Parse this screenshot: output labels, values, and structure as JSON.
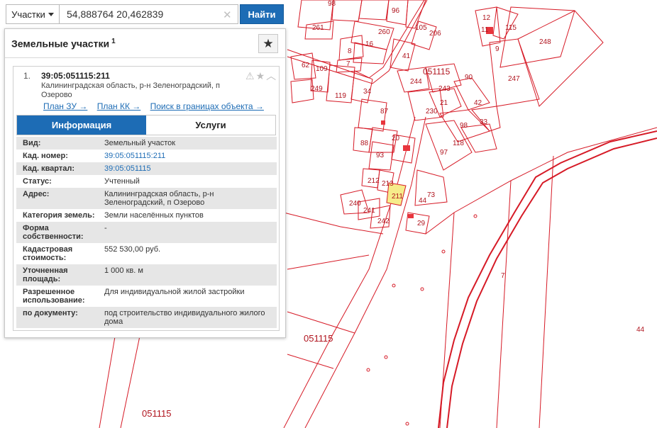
{
  "map": {
    "colors": {
      "boundary": "#d61a26",
      "highlight": "#f6ec8a",
      "label": "#b0141e",
      "building": "#e8353d"
    },
    "quarter_labels": [
      "051115",
      "051115",
      "051115"
    ],
    "parcel_labels": [
      "96",
      "98",
      "206",
      "105",
      "260",
      "261",
      "16",
      "8",
      "7",
      "62",
      "109",
      "249",
      "119",
      "34",
      "41",
      "244",
      "243",
      "90",
      "230",
      "21",
      "42",
      "98",
      "33",
      "118",
      "97",
      "87",
      "88",
      "20",
      "93",
      "212",
      "213",
      "211",
      "73",
      "44",
      "29",
      "240",
      "241",
      "242",
      "12",
      "11",
      "115",
      "248",
      "9",
      "247",
      "7",
      "44"
    ]
  },
  "search": {
    "layer_label": "Участки",
    "query": "54,888764 20,462839",
    "button_label": "Найти"
  },
  "panel": {
    "title": "Земельные участки",
    "title_count": "1",
    "result": {
      "index": "1.",
      "cad_number": "39:05:051115:211",
      "address": "Калининградская область, р-н Зеленоградский, п Озерово",
      "links": [
        "План ЗУ →",
        "План КК →",
        "Поиск в границах объекта →"
      ]
    },
    "tabs": [
      "Информация",
      "Услуги"
    ],
    "info_rows": [
      {
        "label": "Вид:",
        "value": "Земельный участок",
        "link": false
      },
      {
        "label": "Кад. номер:",
        "value": "39:05:051115:211",
        "link": true
      },
      {
        "label": "Кад. квартал:",
        "value": "39:05:051115",
        "link": true
      },
      {
        "label": "Статус:",
        "value": "Учтенный",
        "link": false
      },
      {
        "label": "Адрес:",
        "value": "Калининградская область, р-н Зеленоградский, п Озерово",
        "link": false
      },
      {
        "label": "Категория земель:",
        "value": "Земли населённых пунктов",
        "link": false
      },
      {
        "label": "Форма собственности:",
        "value": "-",
        "link": false
      },
      {
        "label": "Кадастровая стоимость:",
        "value": "552 530,00 руб.",
        "link": false
      },
      {
        "label": "Уточненная площадь:",
        "value": "1 000 кв. м",
        "link": false
      },
      {
        "label": "Разрешенное использование:",
        "value": "Для индивидуальной жилой застройки",
        "link": false
      },
      {
        "label": "по документу:",
        "value": "под строительство индивидуального жилого дома",
        "link": false
      }
    ]
  }
}
